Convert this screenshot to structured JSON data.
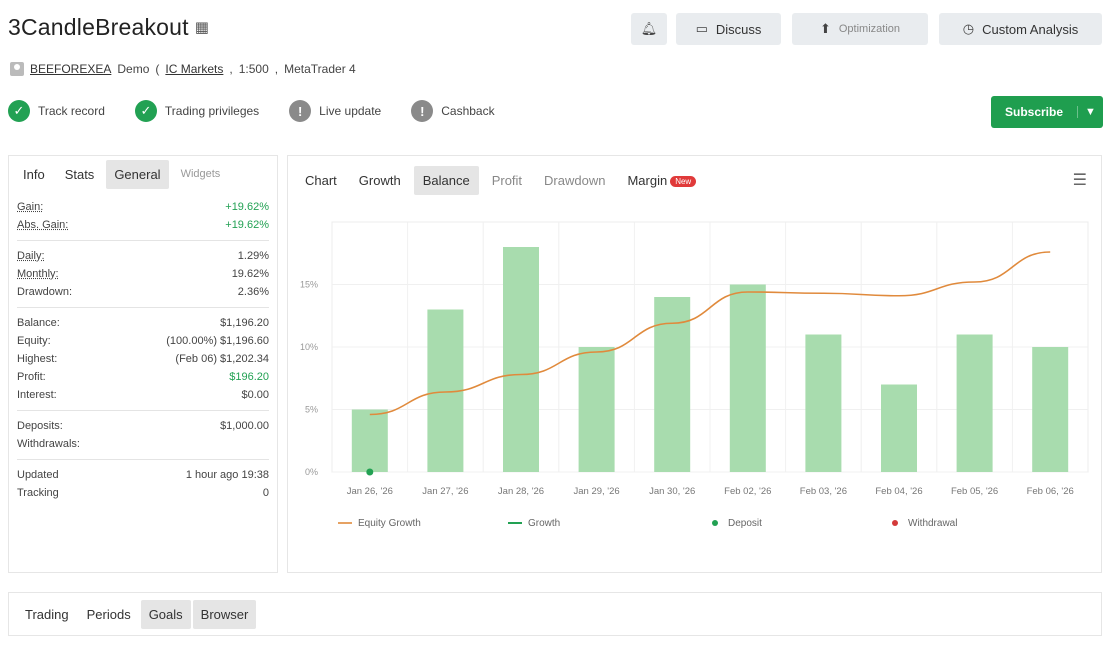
{
  "header": {
    "title": "3CandleBreakout",
    "title_icon": "qr-code-icon",
    "buttons": {
      "notify_icon": "bell-icon",
      "discuss": "Discuss",
      "second_label": "Optimization",
      "custom_analysis": "Custom Analysis"
    }
  },
  "account": {
    "owner": "BEEFOREXEA",
    "type": "Demo",
    "broker": "IC Markets",
    "leverage": "1:500",
    "platform": "MetaTrader 4"
  },
  "badges": [
    {
      "label": "Track record",
      "status": "verified"
    },
    {
      "label": "Trading privileges",
      "status": "verified"
    },
    {
      "label": "Live update",
      "status": "unverified"
    },
    {
      "label": "Cashback",
      "status": "unverified"
    }
  ],
  "subscribe": {
    "label": "Subscribe"
  },
  "left_tabs": [
    "Info",
    "Stats",
    "General",
    "Widgets"
  ],
  "stats": {
    "gain": {
      "label": "Gain:",
      "value": "+19.62%"
    },
    "abs_gain": {
      "label": "Abs. Gain:",
      "value": "+19.62%"
    },
    "daily": {
      "label": "Daily:",
      "value": "1.29%"
    },
    "monthly": {
      "label": "Monthly:",
      "value": "19.62%"
    },
    "drawdown": {
      "label": "Drawdown:",
      "value": "2.36%"
    },
    "balance": {
      "label": "Balance:",
      "value": "$1,196.20"
    },
    "equity": {
      "label": "Equity:",
      "value": "(100.00%) $1,196.60"
    },
    "highest": {
      "label": "Highest:",
      "value": "(Feb 06) $1,202.34"
    },
    "profit": {
      "label": "Profit:",
      "value": "$196.20"
    },
    "interest": {
      "label": "Interest:",
      "value": "$0.00"
    },
    "deposits": {
      "label": "Deposits:",
      "value": "$1,000.00"
    },
    "withdrawals": {
      "label": "Withdrawals:",
      "value": ""
    },
    "updated": {
      "label": "Updated",
      "value": "1 hour ago 19:38"
    },
    "tracking": {
      "label": "Tracking",
      "value": "0"
    }
  },
  "chart_tabs": [
    "Chart",
    "Growth",
    "Balance",
    "Profit",
    "Drawdown",
    "Margin"
  ],
  "chart_new_badge": "New",
  "chart_data": {
    "type": "bar",
    "categories": [
      "Jan 26, '26",
      "Jan 27, '26",
      "Jan 28, '26",
      "Jan 29, '26",
      "Jan 30, '26",
      "Feb 02, '26",
      "Feb 03, '26",
      "Feb 04, '26",
      "Feb 05, '26",
      "Feb 06, '26"
    ],
    "series": [
      {
        "name": "Growth",
        "type": "bar",
        "color": "#a8dcae",
        "values": [
          5,
          13,
          18,
          10,
          14,
          15,
          11,
          7,
          11,
          10
        ]
      },
      {
        "name": "Equity Growth",
        "type": "line",
        "color": "#e08a3c",
        "values": [
          4.6,
          6.4,
          7.8,
          9.6,
          11.9,
          14.4,
          14.3,
          14.1,
          15.2,
          17.6
        ]
      }
    ],
    "yticks": [
      "0%",
      "5%",
      "10%",
      "15%"
    ],
    "ylim": [
      0,
      20
    ],
    "deposit_points": [
      {
        "x": "Jan 26, '26",
        "y": 0
      }
    ],
    "legend": [
      "Equity Growth",
      "Growth",
      "Deposit",
      "Withdrawal"
    ],
    "legend_colors": [
      "#e08a3c",
      "#22a153",
      "#22a153",
      "#d33a3a"
    ]
  },
  "bottom_tabs": [
    "Trading",
    "Periods",
    "Goals",
    "Browser"
  ]
}
